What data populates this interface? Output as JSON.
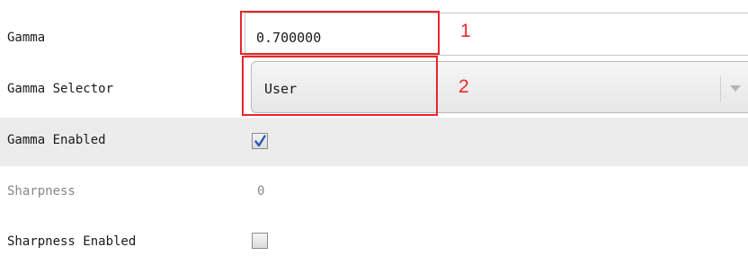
{
  "properties": {
    "gamma": {
      "label": "Gamma",
      "value": "0.700000"
    },
    "gamma_selector": {
      "label": "Gamma Selector",
      "selected": "User",
      "arrow_icon": "chevron-down-icon"
    },
    "gamma_enabled": {
      "label": "Gamma Enabled",
      "checked": true,
      "check_icon": "checkmark-icon"
    },
    "sharpness": {
      "label": "Sharpness",
      "value": "0",
      "disabled": true
    },
    "sharpness_enabled": {
      "label": "Sharpness Enabled",
      "checked": false
    }
  },
  "annotations": [
    {
      "number": "1",
      "target": "gamma-input"
    },
    {
      "number": "2",
      "target": "gamma-selector-dropdown"
    }
  ],
  "colors": {
    "annotation_red": "#e8262a",
    "check_blue": "#2a5bb8",
    "highlight_row": "#ececec",
    "disabled_text": "#888888"
  }
}
